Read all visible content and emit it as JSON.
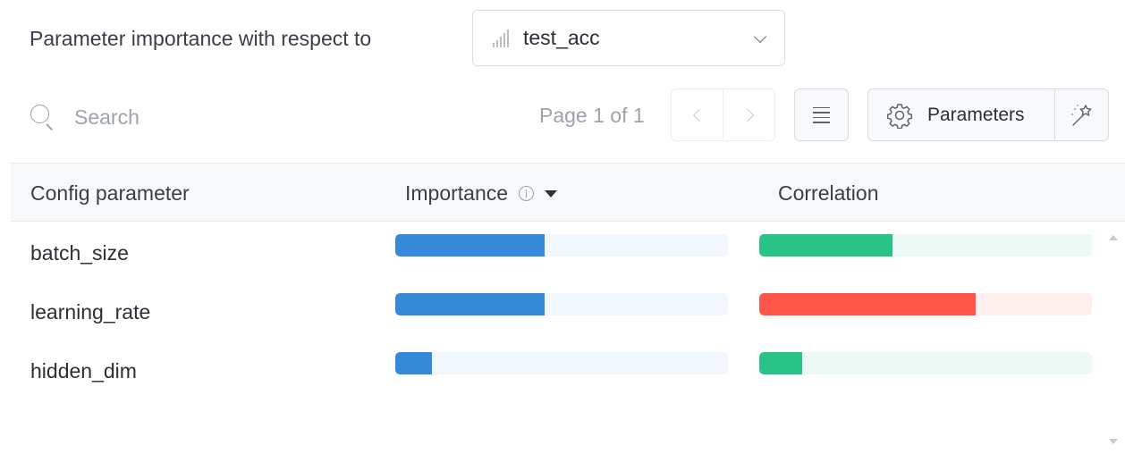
{
  "header": {
    "title": "Parameter importance with respect to",
    "metric": {
      "value": "test_acc",
      "icon": "bar-chart-icon"
    }
  },
  "toolbar": {
    "search_placeholder": "Search",
    "page_text": "Page 1 of 1",
    "parameters_label": "Parameters"
  },
  "table": {
    "columns": {
      "config": "Config parameter",
      "importance": "Importance",
      "correlation": "Correlation"
    },
    "sort": "importance-desc",
    "rows": [
      {
        "name": "batch_size",
        "importance": 0.45,
        "correlation": 0.4,
        "correlation_sign": "positive"
      },
      {
        "name": "learning_rate",
        "importance": 0.45,
        "correlation": -0.65,
        "correlation_sign": "negative"
      },
      {
        "name": "hidden_dim",
        "importance": 0.11,
        "correlation": 0.13,
        "correlation_sign": "positive"
      }
    ]
  },
  "colors": {
    "importance": "#3689d6",
    "importance_track": "#f1f7fd",
    "positive": "#28c387",
    "positive_track": "#edf9f4",
    "negative": "#ff5649",
    "negative_track": "#fff0ef"
  }
}
